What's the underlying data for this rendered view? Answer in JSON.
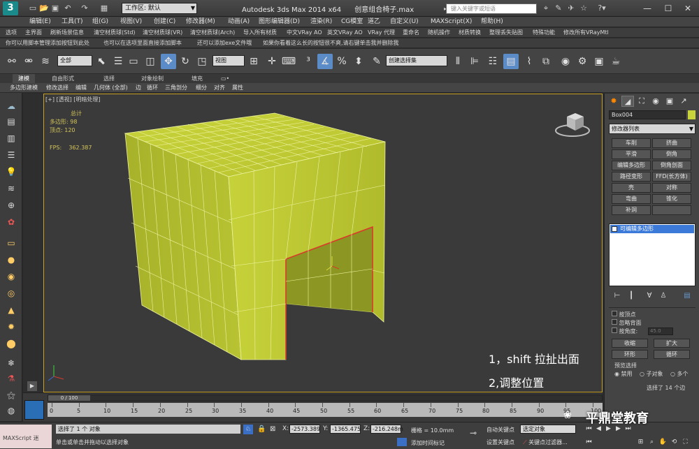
{
  "titlebar": {
    "workspace_label": "工作区: 默认",
    "app_title": "Autodesk 3ds Max  2014 x64",
    "file_name": "创意组合椅子.max",
    "search_placeholder": "键入关键字或短语",
    "controls": [
      "—",
      "☐",
      "✕"
    ]
  },
  "menu": [
    "编辑(E)",
    "工具(T)",
    "组(G)",
    "视图(V)",
    "创建(C)",
    "修改器(M)",
    "动画(A)",
    "图形编辑器(D)",
    "渲染(R)",
    "CG模室",
    "道乙",
    "自定义(U)",
    "MAXScript(X)",
    "帮助(H)"
  ],
  "scriptbar1": [
    "选项",
    "主界面",
    "刷新场景信息",
    "清空材质球(Std)",
    "清空材质球(VR)",
    "清空材质球(Arch)",
    "导入所有材质",
    "中文VRay AO",
    "英文VRay AO",
    "VRay 代理",
    "重命名",
    "随机操作",
    "材质转换",
    "整理丢失贴图",
    "特殊功能",
    "修改所有VRayMtl"
  ],
  "scriptbar2": [
    "你可以用脚本管理添加按钮到此处",
    "也可以在选项里面直接添加脚本",
    "还可以添加exe文件哦",
    "如果你看着这么长的按钮很不爽,请右键单击我并删除我"
  ],
  "maintoolbar": {
    "selection_filter": "全部",
    "ref_coord": "视图",
    "named_selection": "创建选择集"
  },
  "ribbon_tabs": [
    "建模",
    "自由形式",
    "选择",
    "对象绘制",
    "填充",
    "▭•"
  ],
  "ribbon_sub": [
    "多边形建模",
    "修改选择",
    "编辑",
    "几何体 (全部)",
    "边",
    "循环",
    "三角剖分",
    "细分",
    "对齐",
    "属性"
  ],
  "viewport": {
    "label": "[+] [透视] [明暗处理]",
    "stats_header": "总计",
    "polys_label": "多边形:",
    "polys_value": "98",
    "verts_label": "顶点:",
    "verts_value": "120",
    "fps_label": "FPS:",
    "fps_value": "362.387",
    "annotation1": "1，shift 拉扯出面",
    "annotation2": "2,调整位置",
    "object_color": "#c8d23a"
  },
  "command_panel": {
    "object_name": "Box004",
    "modifier_list": "修改器列表",
    "modifier_buttons": [
      "车削",
      "挤曲",
      "平滑",
      "倒角",
      "编辑多边形",
      "倒角剖面",
      "路径变形",
      "FFD(长方体)",
      "壳",
      "对称",
      "弯曲",
      "锥化",
      "补洞",
      ""
    ],
    "stack_item": "可编辑多边形",
    "params": {
      "by_vertex": "按顶点",
      "ignore_backfacing": "忽略背面",
      "by_angle": "按角度:",
      "angle_value": "45.0",
      "shrink": "收缩",
      "grow": "扩大",
      "ring": "环形",
      "loop": "循环",
      "preview_title": "预览选择",
      "disabled": "禁用",
      "subobject": "子对象",
      "multi": "多个",
      "selected_info": "选择了 14 个边"
    }
  },
  "timeline": {
    "frame_display": "0 / 100",
    "ticks": [
      "0",
      "5",
      "10",
      "15",
      "20",
      "25",
      "30",
      "35",
      "40",
      "45",
      "50",
      "55",
      "60",
      "65",
      "70",
      "75",
      "80",
      "85",
      "90",
      "95",
      "100"
    ]
  },
  "statusbar": {
    "maxscript_label": "MAXScript 迷",
    "status_line": "选择了 1 个 对象",
    "prompt_line": "单击或单击并拖动以选择对象",
    "x_label": "X:",
    "x_value": "-2573.389",
    "y_label": "Y:",
    "y_value": "-1365.475",
    "z_label": "Z:",
    "z_value": "-216.248m",
    "grid": "栅格 = 10.0mm",
    "add_time_tag": "添加时间标记",
    "auto_key": "自动关键点",
    "set_key": "设置关键点",
    "selected_filter": "选定对象",
    "key_filters": "关键点过滤器..."
  },
  "watermark": "平鼎堂教育"
}
